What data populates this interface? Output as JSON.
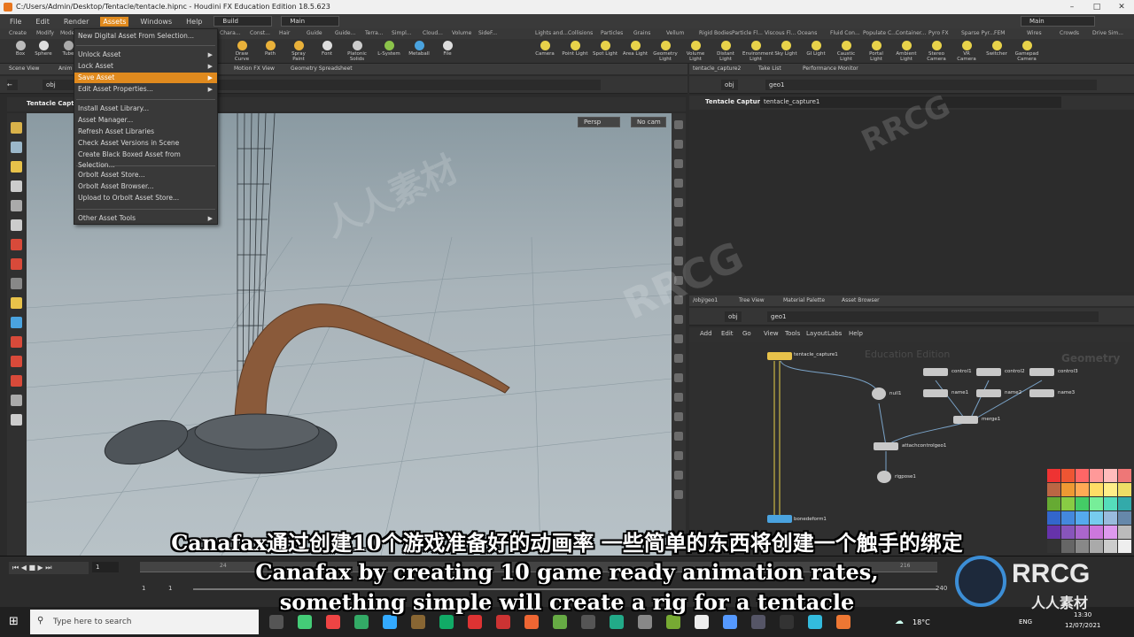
{
  "window": {
    "title": "C:/Users/Admin/Desktop/Tentacle/tentacle.hipnc - Houdini FX Education Edition 18.5.623"
  },
  "menu": {
    "items": [
      "File",
      "Edit",
      "Render",
      "Assets",
      "Windows",
      "Help"
    ],
    "active": "Assets",
    "desktop": "Build",
    "desk2": "Main",
    "desk_right": "Main"
  },
  "shelf_tabs_left": [
    "Create",
    "Modify",
    "Mode",
    "Chara...",
    "Const...",
    "Hair",
    "Guide",
    "Guide...",
    "Terra...",
    "Simpl...",
    "Cloud...",
    "Volume",
    "SideF..."
  ],
  "shelf_tabs_right": [
    "Lights and...",
    "Collisions",
    "Particles",
    "Grains",
    "Vellum",
    "Rigid Bodies",
    "Particle Fl...",
    "Viscous Fl...",
    "Oceans",
    "Fluid Con...",
    "Populate C...",
    "Container...",
    "Pyro FX",
    "Sparse Pyr...",
    "FEM",
    "Wires",
    "Crowds",
    "Drive Sim..."
  ],
  "tools_left": [
    {
      "label": "Box",
      "icon": "box-icon"
    },
    {
      "label": "Sphere",
      "icon": "sphere-icon"
    },
    {
      "label": "Tube",
      "icon": "tube-icon"
    },
    {
      "label": "Draw Curve",
      "icon": "draw-curve-icon"
    },
    {
      "label": "Path",
      "icon": "path-icon"
    },
    {
      "label": "Spray Paint",
      "icon": "spray-paint-icon"
    },
    {
      "label": "Font",
      "icon": "font-icon"
    },
    {
      "label": "Platonic Solids",
      "icon": "platonic-icon"
    },
    {
      "label": "L-System",
      "icon": "lsystem-icon"
    },
    {
      "label": "Metaball",
      "icon": "metaball-icon"
    },
    {
      "label": "File",
      "icon": "file-icon"
    }
  ],
  "tools_right": [
    {
      "label": "Camera"
    },
    {
      "label": "Point Light"
    },
    {
      "label": "Spot Light"
    },
    {
      "label": "Area Light"
    },
    {
      "label": "Geometry Light"
    },
    {
      "label": "Volume Light"
    },
    {
      "label": "Distant Light"
    },
    {
      "label": "Environment Light"
    },
    {
      "label": "Sky Light"
    },
    {
      "label": "GI Light"
    },
    {
      "label": "Caustic Light"
    },
    {
      "label": "Portal Light"
    },
    {
      "label": "Ambient Light"
    },
    {
      "label": "Stereo Camera"
    },
    {
      "label": "VR Camera"
    },
    {
      "label": "Switcher"
    },
    {
      "label": "Gamepad Camera"
    }
  ],
  "pane_tabs_left": [
    "Scene View",
    "Anim",
    "Motion FX View",
    "Geometry Spreadsheet"
  ],
  "pane_tabs_right": [
    "tentacle_capture2",
    "Take List",
    "Performance Monitor"
  ],
  "left_path": "obj",
  "viewport": {
    "title": "Tentacle Captur",
    "persp": "Persp",
    "cam": "No cam"
  },
  "param": {
    "path_obj": "obj",
    "path_geo": "geo1",
    "node_type": "Tentacle Capture",
    "node_name": "tentacle_capture1"
  },
  "net_tabs": [
    "/obj/geo1",
    "Tree View",
    "Material Palette",
    "Asset Browser"
  ],
  "net": {
    "path_obj": "obj",
    "path_geo": "geo1",
    "menu": [
      "Add",
      "Edit",
      "Go",
      "View",
      "Tools",
      "Layout",
      "Labs",
      "Help"
    ],
    "watermark_left": "Education Edition",
    "watermark_right": "Geometry",
    "nodes": [
      "tentacle_capture1",
      "control1",
      "control2",
      "control3",
      "name1",
      "name2",
      "name3",
      "null1",
      "merge1",
      "attachcontrolgeo1",
      "rigpose1",
      "bonedeform1"
    ]
  },
  "dropdown": {
    "items": [
      {
        "label": "New Digital Asset From Selection...",
        "submenu": false
      },
      {
        "label": "Unlock Asset",
        "submenu": true
      },
      {
        "label": "Lock Asset",
        "submenu": true
      },
      {
        "label": "Save Asset",
        "submenu": true,
        "highlighted": true
      },
      {
        "label": "Edit Asset Properties...",
        "submenu": true
      },
      {
        "label": "Install Asset Library...",
        "submenu": false
      },
      {
        "label": "Asset Manager...",
        "submenu": false
      },
      {
        "label": "Refresh Asset Libraries",
        "submenu": false
      },
      {
        "label": "Check Asset Versions in Scene",
        "submenu": false
      },
      {
        "label": "Create Black Boxed Asset from Selection...",
        "submenu": false
      },
      {
        "label": "Orbolt Asset Store...",
        "submenu": false
      },
      {
        "label": "Orbolt Asset Browser...",
        "submenu": false
      },
      {
        "label": "Upload to Orbolt Asset Store...",
        "submenu": false
      },
      {
        "label": "Other Asset Tools",
        "submenu": true
      }
    ]
  },
  "timeline": {
    "frame": "1",
    "start": "1",
    "start2": "1",
    "end": "240",
    "ticks": [
      "24",
      "216"
    ]
  },
  "subtitles": {
    "cn": "Canafax通过创建10个游戏准备好的动画率 一些简单的东西将创建一个触手的绑定",
    "en1": "Canafax by creating 10 game ready animation rates,",
    "en2": "something simple will create a rig for a tentacle"
  },
  "taskbar": {
    "search_placeholder": "Type here to search",
    "temp": "18°C",
    "lang": "ENG",
    "time": "13:30",
    "date": "12/07/2021"
  },
  "watermark": {
    "brand": "RRCG",
    "cn": "人人素材"
  },
  "colors": {
    "accent": "#e08a1e",
    "tentacle": "#8a5a3a"
  }
}
